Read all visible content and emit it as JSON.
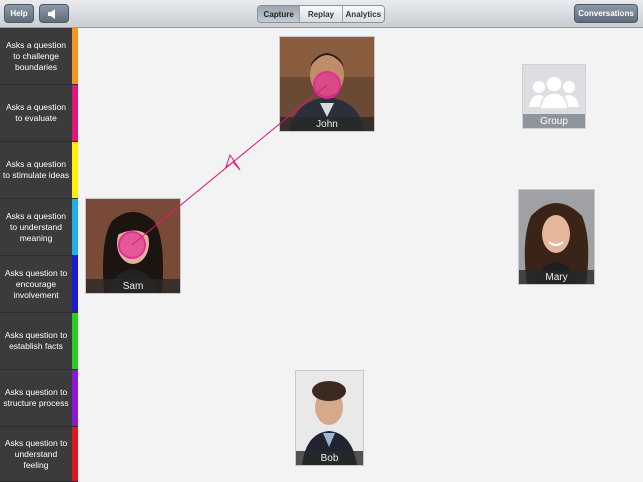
{
  "toolbar": {
    "help_label": "Help",
    "sound_icon": "speaker-icon",
    "tabs": [
      {
        "label": "Capture",
        "active": true
      },
      {
        "label": "Replay",
        "active": false
      },
      {
        "label": "Analytics",
        "active": false
      }
    ],
    "conversations_label": "Conversations"
  },
  "sidebar": {
    "categories": [
      {
        "label": "Asks a question to challenge boundaries",
        "color": "#f7941d"
      },
      {
        "label": "Asks a question to evaluate",
        "color": "#e4147a"
      },
      {
        "label": "Asks a question to stimulate ideas",
        "color": "#ffee00"
      },
      {
        "label": "Asks a question to understand meaning",
        "color": "#22aee8"
      },
      {
        "label": "Asks question to encourage involvement",
        "color": "#1b1bd6"
      },
      {
        "label": "Asks question to establish facts",
        "color": "#27d01f"
      },
      {
        "label": "Asks question to structure process",
        "color": "#8a17d6"
      },
      {
        "label": "Asks question to understand feeling",
        "color": "#e5161b"
      }
    ]
  },
  "participants": [
    {
      "name": "John"
    },
    {
      "name": "Sam"
    },
    {
      "name": "Mary"
    },
    {
      "name": "Bob"
    }
  ],
  "group": {
    "name": "Group",
    "icon": "group-icon"
  },
  "interaction": {
    "from": "Sam",
    "to": "John",
    "color": "#e4147a"
  }
}
